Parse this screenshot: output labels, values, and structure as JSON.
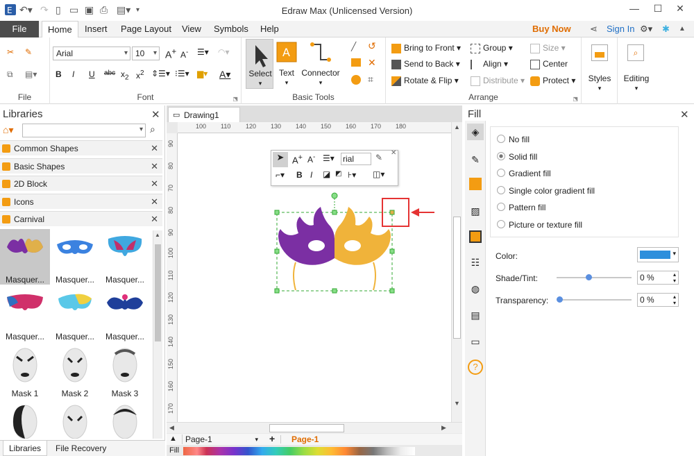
{
  "app": {
    "title": "Edraw Max (Unlicensed Version)"
  },
  "menu": {
    "file": "File",
    "tabs": [
      "Home",
      "Insert",
      "Page Layout",
      "View",
      "Symbols",
      "Help"
    ],
    "buy_now": "Buy Now",
    "sign_in": "Sign In"
  },
  "ribbon": {
    "file_group": "File",
    "font_group": "Font",
    "font_name": "Arial",
    "font_size": "10",
    "basic_tools_group": "Basic Tools",
    "select": "Select",
    "text": "Text",
    "connector": "Connector",
    "arrange_group": "Arrange",
    "bring_to_front": "Bring to Front",
    "send_to_back": "Send to Back",
    "rotate_flip": "Rotate & Flip",
    "group": "Group",
    "align": "Align",
    "distribute": "Distribute",
    "size": "Size",
    "center": "Center",
    "protect": "Protect",
    "styles": "Styles",
    "editing": "Editing"
  },
  "libraries": {
    "title": "Libraries",
    "items": [
      "Common Shapes",
      "Basic Shapes",
      "2D Block",
      "Icons",
      "Carnival"
    ],
    "shapes": [
      "Masquer...",
      "Masquer...",
      "Masquer...",
      "Masquer...",
      "Masquer...",
      "Masquer...",
      "Mask 1",
      "Mask 2",
      "Mask 3"
    ],
    "bottom_tabs": [
      "Libraries",
      "File Recovery"
    ]
  },
  "document": {
    "tab": "Drawing1",
    "ruler_top": [
      "100",
      "110",
      "120",
      "130",
      "140",
      "150",
      "160",
      "170",
      "180"
    ],
    "ruler_left": [
      "90",
      "80",
      "70",
      "80",
      "90",
      "100",
      "110",
      "120",
      "130",
      "140",
      "150",
      "160",
      "170"
    ],
    "mini_font": "rial",
    "page_select": "Page-1",
    "page_tab": "Page-1",
    "fill_label": "Fill"
  },
  "fill_panel": {
    "title": "Fill",
    "options": [
      "No fill",
      "Solid fill",
      "Gradient fill",
      "Single color gradient fill",
      "Pattern fill",
      "Picture or texture fill"
    ],
    "selected": "Solid fill",
    "color_label": "Color:",
    "color_value": "#2e8fdc",
    "shade_label": "Shade/Tint:",
    "shade_value": "0 %",
    "shade_level": 0.42,
    "transparency_label": "Transparency:",
    "transparency_value": "0 %",
    "transparency_level": 0.0
  },
  "colors": {
    "accent": "#e06c00",
    "menu_dark": "#4c4c4c",
    "buy": "#e06c00",
    "sign_in": "#1f6fc5",
    "mask_purple": "#7b2fa3",
    "mask_gold": "#f0b33a"
  }
}
